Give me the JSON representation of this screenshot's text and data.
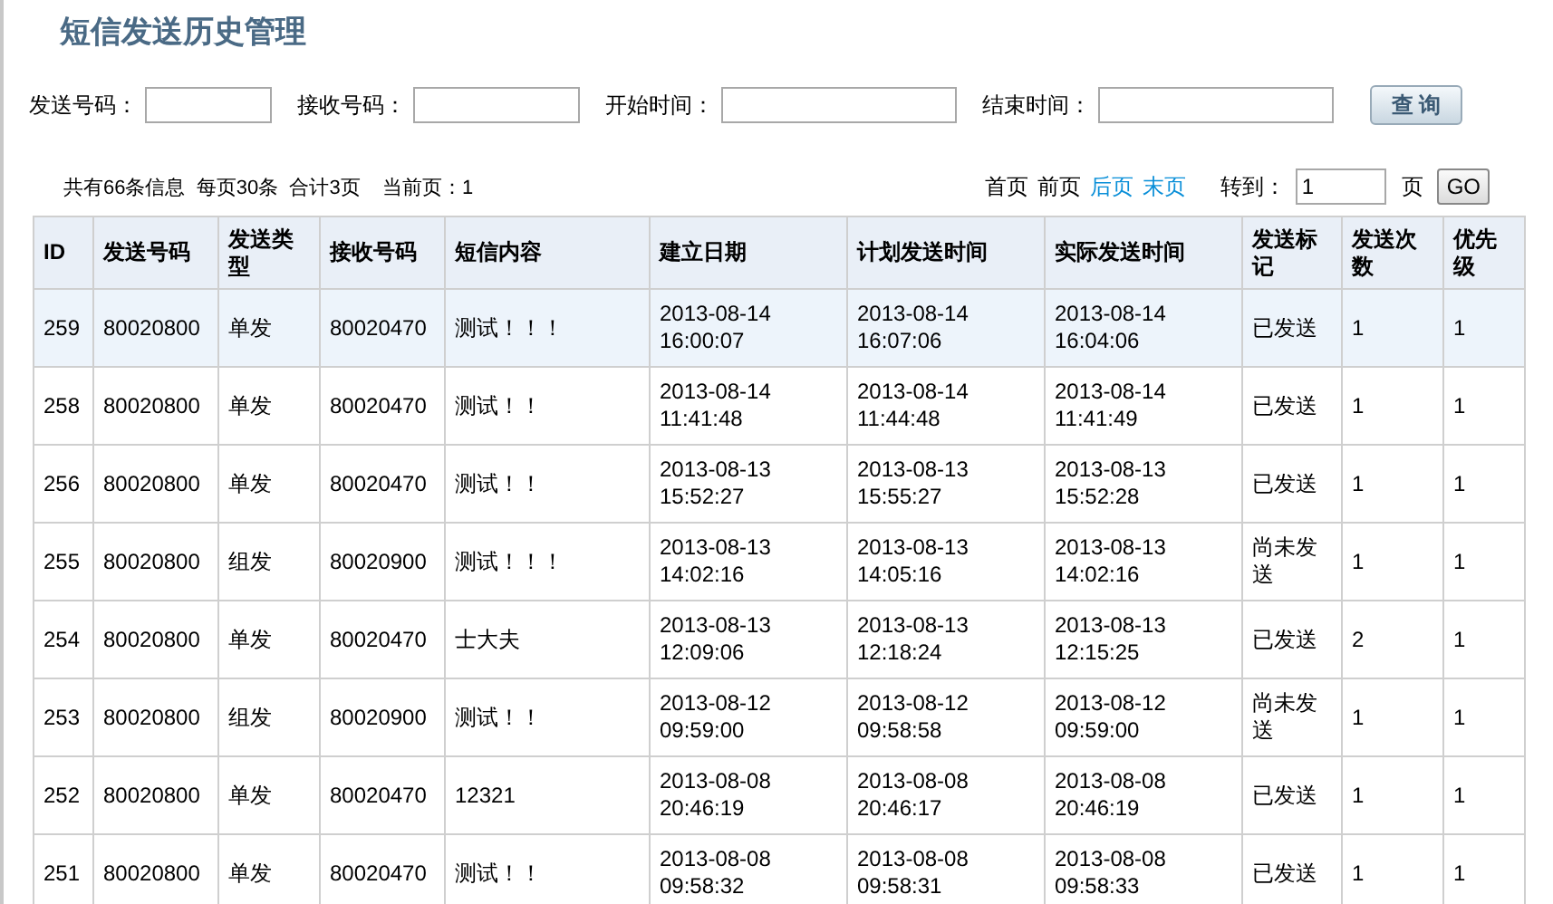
{
  "title": "短信发送历史管理",
  "search": {
    "fields": [
      {
        "label": "发送号码："
      },
      {
        "label": "接收号码："
      },
      {
        "label": "开始时间："
      },
      {
        "label": "结束时间："
      }
    ],
    "button": "查 询"
  },
  "summary": "共有66条信息  每页30条  合计3页    当前页：1",
  "pager": {
    "links": [
      {
        "label": "首页",
        "disabled": true
      },
      {
        "label": "前页",
        "disabled": true
      },
      {
        "label": "后页",
        "disabled": false
      },
      {
        "label": "末页",
        "disabled": false
      }
    ],
    "goto_label": "转到：",
    "page_value": "1",
    "page_unit": "页",
    "go_button": "GO"
  },
  "table": {
    "columns": [
      "ID",
      "发送号码",
      "发送类型",
      "接收号码",
      "短信内容",
      "建立日期",
      "计划发送时间",
      "实际发送时间",
      "发送标记",
      "发送次数",
      "优先级"
    ],
    "rows": [
      {
        "selected": true,
        "cells": [
          "259",
          "80020800",
          "单发",
          "80020470",
          "测试！！！",
          "2013-08-14 16:00:07",
          "2013-08-14 16:07:06",
          "2013-08-14 16:04:06",
          "已发送",
          "1",
          "1"
        ]
      },
      {
        "selected": false,
        "cells": [
          "258",
          "80020800",
          "单发",
          "80020470",
          "测试！！",
          "2013-08-14 11:41:48",
          "2013-08-14 11:44:48",
          "2013-08-14 11:41:49",
          "已发送",
          "1",
          "1"
        ]
      },
      {
        "selected": false,
        "cells": [
          "256",
          "80020800",
          "单发",
          "80020470",
          "测试！！",
          "2013-08-13 15:52:27",
          "2013-08-13 15:55:27",
          "2013-08-13 15:52:28",
          "已发送",
          "1",
          "1"
        ]
      },
      {
        "selected": false,
        "cells": [
          "255",
          "80020800",
          "组发",
          "80020900",
          "测试！！！",
          "2013-08-13 14:02:16",
          "2013-08-13 14:05:16",
          "2013-08-13 14:02:16",
          "尚未发送",
          "1",
          "1"
        ]
      },
      {
        "selected": false,
        "cells": [
          "254",
          "80020800",
          "单发",
          "80020470",
          "士大夫",
          "2013-08-13 12:09:06",
          "2013-08-13 12:18:24",
          "2013-08-13 12:15:25",
          "已发送",
          "2",
          "1"
        ]
      },
      {
        "selected": false,
        "cells": [
          "253",
          "80020800",
          "组发",
          "80020900",
          "测试！！",
          "2013-08-12 09:59:00",
          "2013-08-12 09:58:58",
          "2013-08-12 09:59:00",
          "尚未发送",
          "1",
          "1"
        ]
      },
      {
        "selected": false,
        "cells": [
          "252",
          "80020800",
          "单发",
          "80020470",
          "12321",
          "2013-08-08 20:46:19",
          "2013-08-08 20:46:17",
          "2013-08-08 20:46:19",
          "已发送",
          "1",
          "1"
        ]
      },
      {
        "selected": false,
        "cells": [
          "251",
          "80020800",
          "单发",
          "80020470",
          "测试！！",
          "2013-08-08 09:58:32",
          "2013-08-08 09:58:31",
          "2013-08-08 09:58:33",
          "已发送",
          "1",
          "1"
        ]
      }
    ]
  }
}
